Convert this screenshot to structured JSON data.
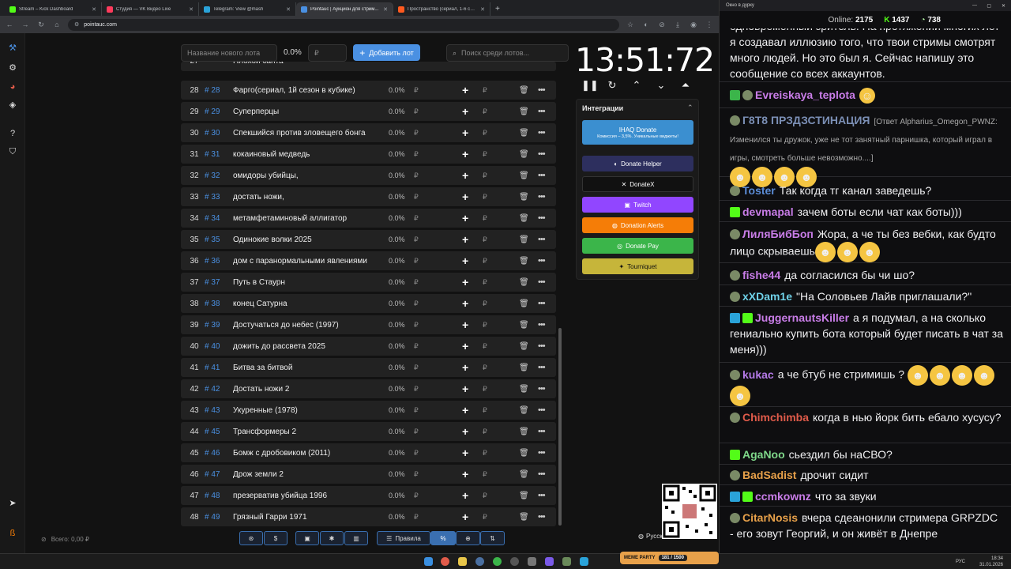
{
  "browser": {
    "tabs": [
      {
        "label": "Stream – Kick Dashboard",
        "color": "#53fc18"
      },
      {
        "label": "Студия — VK Видео Live",
        "color": "#ff3b5c"
      },
      {
        "label": "Telegram: View @mash",
        "color": "#2aa3d9"
      },
      {
        "label": "Pointauc | Аукцион для стрим...",
        "color": "#4a90e2"
      },
      {
        "label": "Пространство (сериал, 1-6 сез...",
        "color": "#ff5a1f"
      }
    ],
    "url": "pointauc.com"
  },
  "toolbar": {
    "new_lot_placeholder": "Название нового лота",
    "percent": "0.0%",
    "amount_placeholder": "₽",
    "add_label": "Добавить лот",
    "search_placeholder": "Поиск среди лотов..."
  },
  "lots": [
    {
      "num": "28",
      "id": "# 28",
      "name": "Фарго(сериал, 1й сезон в кубике)",
      "pct": "0.0%"
    },
    {
      "num": "29",
      "id": "# 29",
      "name": "Суперперцы",
      "pct": "0.0%"
    },
    {
      "num": "30",
      "id": "# 30",
      "name": "Спекшийся против зловещего бонга",
      "pct": "0.0%"
    },
    {
      "num": "31",
      "id": "# 31",
      "name": "кокаиновый медведь",
      "pct": "0.0%"
    },
    {
      "num": "32",
      "id": "# 32",
      "name": "омидоры убийцы,",
      "pct": "0.0%"
    },
    {
      "num": "33",
      "id": "# 33",
      "name": "достать ножи,",
      "pct": "0.0%"
    },
    {
      "num": "34",
      "id": "# 34",
      "name": "метамфетаминовый аллигатор",
      "pct": "0.0%"
    },
    {
      "num": "35",
      "id": "# 35",
      "name": "Одинокие волки 2025",
      "pct": "0.0%"
    },
    {
      "num": "36",
      "id": "# 36",
      "name": "дом с паранормальными явлениями",
      "pct": "0.0%"
    },
    {
      "num": "37",
      "id": "# 37",
      "name": "Путь в Стаурн",
      "pct": "0.0%"
    },
    {
      "num": "38",
      "id": "# 38",
      "name": "конец Сатурна",
      "pct": "0.0%"
    },
    {
      "num": "39",
      "id": "# 39",
      "name": "Достучаться до небес (1997)",
      "pct": "0.0%"
    },
    {
      "num": "40",
      "id": "# 40",
      "name": "дожить до рассвета 2025",
      "pct": "0.0%"
    },
    {
      "num": "41",
      "id": "# 41",
      "name": "Битва за битвой",
      "pct": "0.0%"
    },
    {
      "num": "42",
      "id": "# 42",
      "name": "Достать ножи 2",
      "pct": "0.0%"
    },
    {
      "num": "43",
      "id": "# 43",
      "name": "Укуренные (1978)",
      "pct": "0.0%"
    },
    {
      "num": "44",
      "id": "# 45",
      "name": "Трансформеры 2",
      "pct": "0.0%"
    },
    {
      "num": "45",
      "id": "# 46",
      "name": "Бомж с дробовиком (2011)",
      "pct": "0.0%"
    },
    {
      "num": "46",
      "id": "# 47",
      "name": "Дрож земли 2",
      "pct": "0.0%"
    },
    {
      "num": "47",
      "id": "# 48",
      "name": "презерватив убийца 1996",
      "pct": "0.0%"
    },
    {
      "num": "48",
      "id": "# 49",
      "name": "Грязный Гарри 1971",
      "pct": "0.0%"
    }
  ],
  "partial_lot": {
    "num": "27",
    "name": "Плохой санта"
  },
  "timer": "13:51:72",
  "integrations": {
    "title": "Интеграции",
    "buttons": [
      {
        "label": "IHAQ Donate",
        "sub": "Комиссия – 3,5%. Уникальные виджеты!",
        "color": "#3b8fd0"
      },
      {
        "label": "Donate Helper",
        "color": "#2d2f5e"
      },
      {
        "label": "DonateX",
        "color": "#111111"
      },
      {
        "label": "Twitch",
        "color": "#9146ff"
      },
      {
        "label": "Donation Alerts",
        "color": "#f57d07"
      },
      {
        "label": "Donate Pay",
        "color": "#3bb54a"
      },
      {
        "label": "Tourniquet",
        "color": "#c6b53a"
      }
    ]
  },
  "bottom": {
    "total": "Всего: 0,00 ₽",
    "rules": "Правила",
    "lang": "Русский"
  },
  "chat": {
    "window_title": "Окно в дурку",
    "online_label": "Online:",
    "online": "2175",
    "kick_count": "1437",
    "vk_count": "738",
    "top_text": "одновременный зритель. На протяжении многих лет я создавал иллюзию того, что твои стримы смотрят много людей. Но это был я. Сейчас напишу это сообщение со всех аккаунтов.",
    "messages": [
      {
        "user": "Evreiskaya_teplota",
        "color": "#c97de8",
        "text": ""
      },
      {
        "user": "Г8Т8 ПРЗДЗСТИНАЦИЯ",
        "color": "#7b8fb5",
        "reply": "[Ответ Alpharius_Omegon_PWNZ: Изменился ты дружок, уже не тот занятный парнишка, который играл в игры, смотреть больше невозможно....]",
        "text": ""
      },
      {
        "user": "Toster",
        "color": "#5b8cd6",
        "text": "Так когда тг канал заведешь?"
      },
      {
        "user": "devmapal",
        "color": "#c97de8",
        "text": "зачем боты если чат как боты)))"
      },
      {
        "user": "ЛиляБибБоп",
        "color": "#c97de8",
        "text": "Жора, а че ты без вебки, как будто лицо скрываешь"
      },
      {
        "user": "fishe44",
        "color": "#c97de8",
        "text": "да согласился бы чи шо?"
      },
      {
        "user": "xXDam1e",
        "color": "#6fd1e8",
        "text": "\"На Соловьев Лайв приглашали?\""
      },
      {
        "user": "JuggernautsKiller",
        "color": "#c97de8",
        "text": "а я подумал, а на сколько гениально купить бота который будет писать в чат за меня)))"
      },
      {
        "user": "kukac",
        "color": "#b57ae8",
        "text": "а че бтуб не стримишь ?"
      },
      {
        "user": "Chimchimba",
        "color": "#e05b4a",
        "text": "когда в нью йорк бить ебало хусусу?"
      },
      {
        "user": "AgaNoo",
        "color": "#7fd88a",
        "text": "сьездил бы наСВО?"
      },
      {
        "user": "BadSadist",
        "color": "#e8a14a",
        "text": "дрочит сидит"
      },
      {
        "user": "ccmkownz",
        "color": "#c97de8",
        "text": "что за звуки"
      },
      {
        "user": "CitarNosis",
        "color": "#e8a14a",
        "text": "вчера сдеанонили стримера GRPZDC - его зовут Георгий, и он живёт в Днепре"
      }
    ]
  },
  "taskbar": {
    "lang": "РУС",
    "time": "18:34",
    "date": "31.01.2026",
    "meme_label": "MEME PARTY",
    "meme_count": "181 / 1500"
  }
}
